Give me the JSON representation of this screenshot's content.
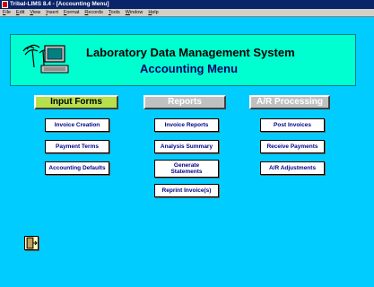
{
  "window": {
    "title": "Tribal-LIMS 8.4 - [Accounting Menu]"
  },
  "menubar": [
    "File",
    "Edit",
    "View",
    "Insert",
    "Format",
    "Records",
    "Tools",
    "Window",
    "Help"
  ],
  "header": {
    "system_title": "Laboratory Data Management System",
    "subtitle": "Accounting Menu"
  },
  "sections": {
    "input_forms": "Input Forms",
    "reports": "Reports",
    "ar_processing": "A/R Processing"
  },
  "input_forms_buttons": [
    "Invoice Creation",
    "Payment Terms",
    "Accounting Defaults"
  ],
  "reports_buttons": [
    "Invoice Reports",
    "Analysis Summary",
    "Generate Statements",
    "Reprint Invoice(s)"
  ],
  "ar_buttons": [
    "Post Invoices",
    "Receive Payments",
    "A/R Adjustments"
  ],
  "colors": {
    "background": "#00ccff",
    "header": "#00ffd0",
    "input_section": "#b8e04a",
    "titlebar": "#0a246a"
  },
  "icons": {
    "app": "tribal-lims-icon",
    "logo": "palm-tree-computer-logo",
    "exit": "exit-door-icon"
  }
}
